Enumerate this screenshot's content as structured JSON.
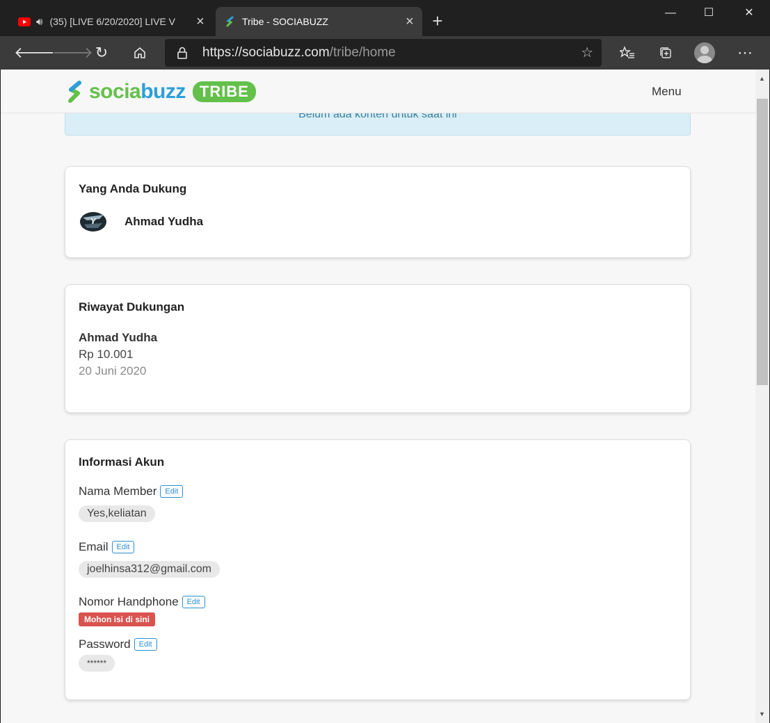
{
  "browser": {
    "tabs": [
      {
        "title": "(35) [LIVE 6/20/2020] LIVE V",
        "active": false,
        "favicon": "youtube-icon",
        "audio": true
      },
      {
        "title": "Tribe - SOCIABUZZ",
        "active": true,
        "favicon": "sociabuzz-icon"
      }
    ],
    "url_host": "https://sociabuzz.com",
    "url_path": "/tribe/home",
    "window_controls": {
      "minimize": "—",
      "maximize": "☐",
      "close": "✕"
    }
  },
  "site": {
    "logo_part1": "socia",
    "logo_part2": "buzz",
    "logo_badge": "TRIBE",
    "menu_label": "Menu",
    "alert_text": "Belum ada konten untuk saat ini",
    "colors": {
      "green": "#63c04a",
      "blue": "#2c9fd8",
      "danger": "#d9534f"
    }
  },
  "supported": {
    "heading": "Yang Anda Dukung",
    "creator_name": "Ahmad Yudha"
  },
  "history": {
    "heading": "Riwayat Dukungan",
    "entries": [
      {
        "name": "Ahmad Yudha",
        "amount": "Rp 10.001",
        "date": "20 Juni 2020"
      }
    ]
  },
  "account": {
    "heading": "Informasi Akun",
    "edit_label": "Edit",
    "member_name_label": "Nama Member",
    "member_name_value": "Yes,keliatan",
    "email_label": "Email",
    "email_value": "joelhinsa312@gmail.com",
    "phone_label": "Nomor Handphone",
    "phone_warning": "Mohon isi di sini",
    "password_label": "Password",
    "password_value": "******"
  }
}
